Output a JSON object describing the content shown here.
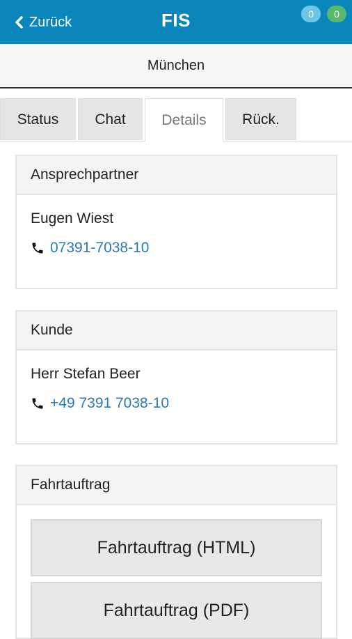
{
  "header": {
    "back_label": "Zurück",
    "title": "FIS",
    "badge_blue": "0",
    "badge_green": "0"
  },
  "location": "München",
  "tabs": [
    {
      "label": "Status",
      "active": false
    },
    {
      "label": "Chat",
      "active": false
    },
    {
      "label": "Details",
      "active": true
    },
    {
      "label": "Rück.",
      "active": false
    }
  ],
  "contact": {
    "heading": "Ansprechpartner",
    "name": "Eugen Wiest",
    "phone": "07391-7038-10"
  },
  "customer": {
    "heading": "Kunde",
    "name": "Herr Stefan Beer",
    "phone": "+49 7391 7038-10"
  },
  "order": {
    "heading": "Fahrtauftrag",
    "html_button": "Fahrtauftrag (HTML)",
    "pdf_button": "Fahrtauftrag (PDF)"
  },
  "colors": {
    "header_bg": "#0a86bd",
    "link": "#2a79b8",
    "badge_blue": "#6fc5e6",
    "badge_green": "#59b96a"
  },
  "icons": {
    "back": "chevron-left-icon",
    "phone": "phone-icon"
  }
}
